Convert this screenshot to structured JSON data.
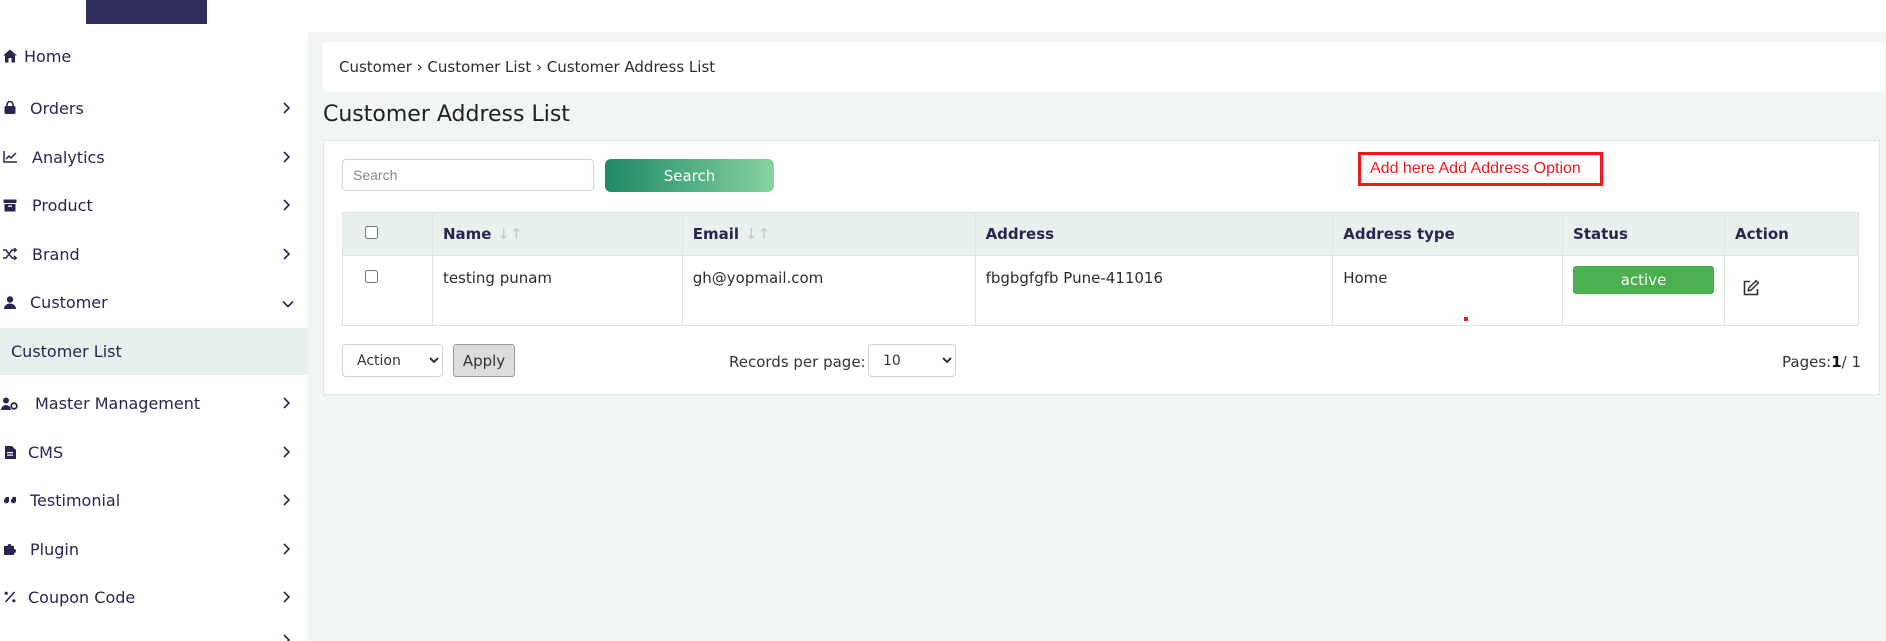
{
  "sidebar": {
    "items": [
      {
        "label": "Home",
        "icon": "home-icon"
      },
      {
        "label": "Orders",
        "icon": "bag-icon"
      },
      {
        "label": "Analytics",
        "icon": "chart-line-icon"
      },
      {
        "label": "Product",
        "icon": "archive-icon"
      },
      {
        "label": "Brand",
        "icon": "shuffle-icon"
      },
      {
        "label": "Customer",
        "icon": "user-icon"
      },
      {
        "label": "Master Management",
        "icon": "user-gear-icon"
      },
      {
        "label": "CMS",
        "icon": "file-icon"
      },
      {
        "label": "Testimonial",
        "icon": "quote-icon"
      },
      {
        "label": "Plugin",
        "icon": "puzzle-icon"
      },
      {
        "label": "Coupon Code",
        "icon": "percent-icon"
      }
    ],
    "sub_item": "Customer List"
  },
  "breadcrumb": "Customer › Customer List › Customer Address List",
  "page_title": "Customer Address List",
  "search": {
    "placeholder": "Search",
    "button": "Search"
  },
  "note": "Add here Add Address Option",
  "table": {
    "headers": [
      "Name",
      "Email",
      "Address",
      "Address type",
      "Status",
      "Action"
    ],
    "rows": [
      {
        "name": "testing punam",
        "email": "gh@yopmail.com",
        "address": "fbgbgfgfb Pune-411016",
        "address_type": "Home",
        "status": "active"
      }
    ]
  },
  "footer": {
    "action_select": "Action",
    "apply": "Apply",
    "records_label": "Records per page:",
    "records_value": "10",
    "pages_prefix": "Pages:",
    "pages_current": "1",
    "pages_total": "/ 1"
  },
  "colors": {
    "accent": "#1d8a66",
    "status_active": "#4caf50",
    "annotation": "#ee1b1b",
    "nav_text": "#2a2550"
  }
}
